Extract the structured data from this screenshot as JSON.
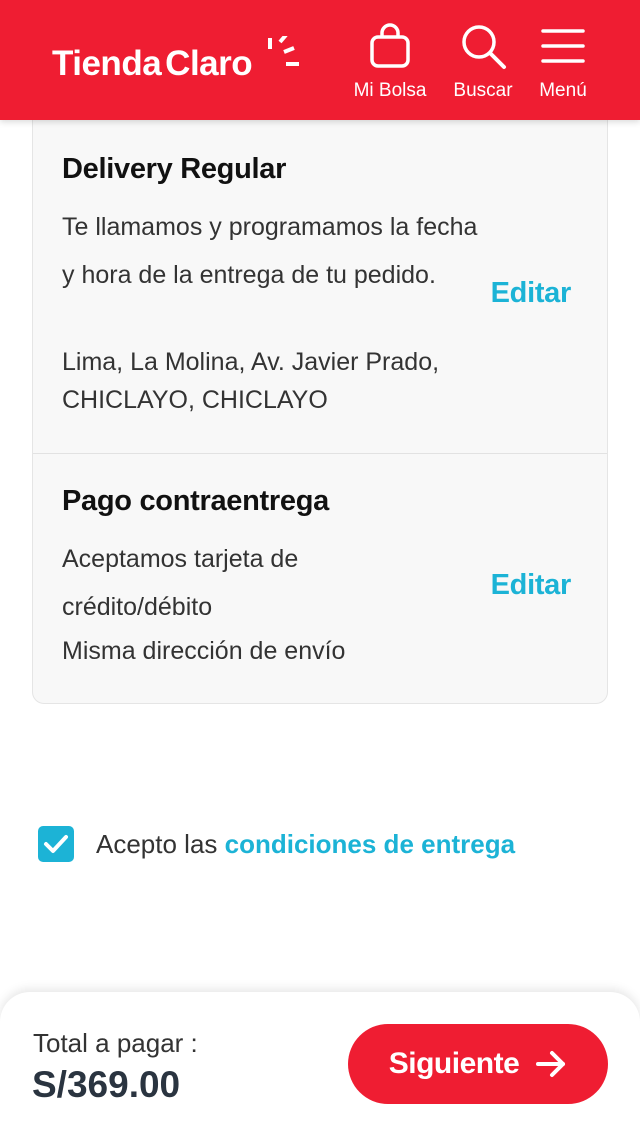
{
  "header": {
    "logo_word1": "Tienda",
    "logo_word2": "Claro",
    "bag_label": "Mi Bolsa",
    "search_label": "Buscar",
    "menu_label": "Menú",
    "brand_color": "#ef1d32"
  },
  "summary": {
    "delivery": {
      "title": "Delivery Regular",
      "description": "Te llamamos y programamos la fecha y hora de la entrega de tu pedido.",
      "address_line1": "Lima, La Molina, Av. Javier Prado,",
      "address_line2": "CHICLAYO, CHICLAYO",
      "edit_label": "Editar"
    },
    "payment": {
      "title": "Pago contraentrega",
      "description": "Aceptamos tarjeta de crédito/débito",
      "note": "Misma dirección de envío",
      "edit_label": "Editar"
    }
  },
  "terms": {
    "checked": true,
    "prefix": "Acepto las ",
    "link": "condiciones de entrega"
  },
  "footer": {
    "total_label": "Total a pagar :",
    "total_amount": "S/369.00",
    "next_label": "Siguiente"
  },
  "colors": {
    "accent": "#1cb3d6",
    "primary": "#ef1d32"
  },
  "icons": [
    "shopping-bag-icon",
    "search-icon",
    "hamburger-menu-icon",
    "checkmark-icon",
    "arrow-right-icon"
  ]
}
